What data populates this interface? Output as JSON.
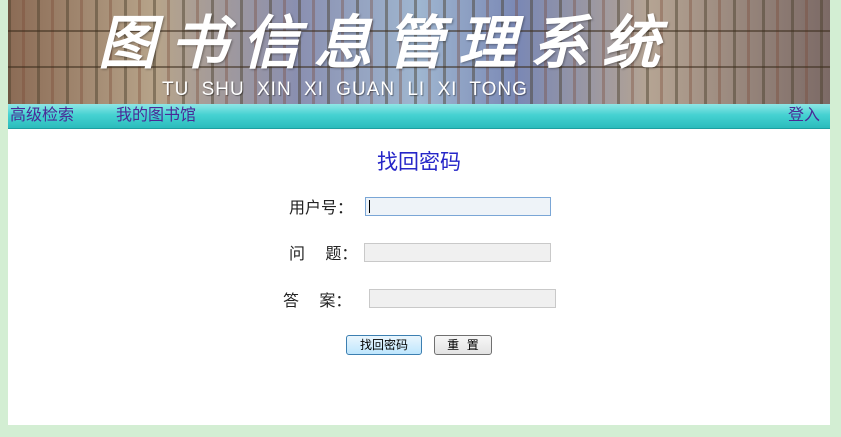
{
  "banner": {
    "title": "图书信息管理系统",
    "subtitle": "TU SHU XIN XI GUAN LI XI TONG"
  },
  "nav": {
    "advanced_search": "高级检索",
    "my_library": "我的图书馆",
    "login": "登入"
  },
  "form": {
    "title": "找回密码",
    "user_label": "用户号：",
    "user_value": "",
    "question_label": "问    题：",
    "question_value": "",
    "answer_label": "答    案：",
    "answer_value": "",
    "submit_label": "找回密码",
    "reset_label": "重  置"
  },
  "colors": {
    "page_bg": "#d3eed3",
    "nav_bar": "#46d2d2",
    "nav_link": "#4a2a96",
    "form_title": "#2626c8"
  }
}
